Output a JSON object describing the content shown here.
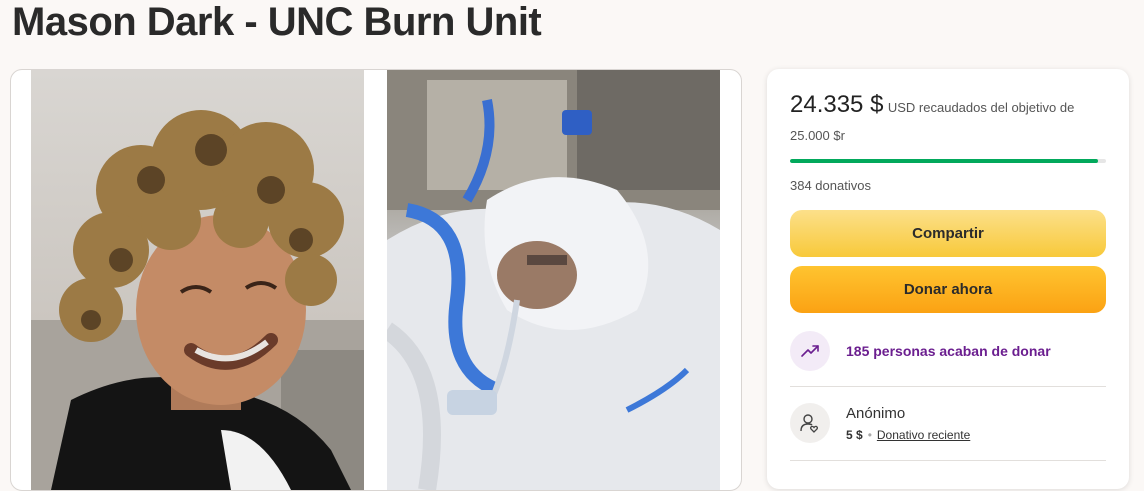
{
  "page": {
    "title": "Mason Dark - UNC Burn Unit"
  },
  "donation": {
    "amount": "24.335 $",
    "goal_text": "USD recaudados del objetivo de 25.000 $r",
    "progress_fraction": 0.9734,
    "donations_count": "384 donativos",
    "share_label": "Compartir",
    "donate_label": "Donar ahora",
    "recent_activity": "185 personas acaban de donar",
    "recent_donor": {
      "name": "Anónimo",
      "amount": "5 $",
      "label": "Donativo reciente"
    }
  },
  "colors": {
    "progress": "#02a95c",
    "share_button": "#f8c93a",
    "donate_button": "#fba213",
    "activity_text": "#6b1e8f"
  },
  "icons": {
    "activity": "trending-up-icon",
    "donor": "user-heart-icon"
  }
}
